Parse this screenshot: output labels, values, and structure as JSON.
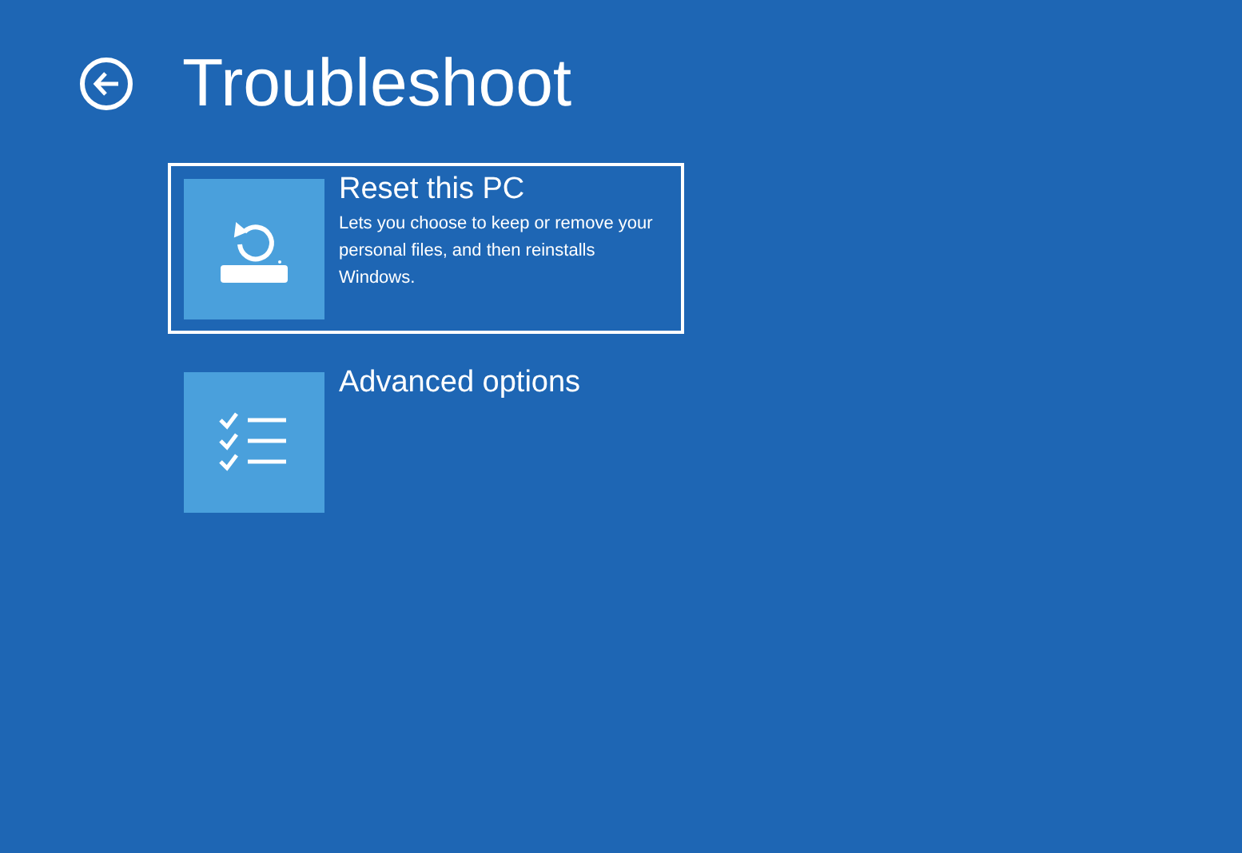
{
  "title": "Troubleshoot",
  "options": [
    {
      "kind": "reset",
      "label": "Reset this PC",
      "description": "Lets you choose to keep or remove your personal files, and then reinstalls Windows.",
      "selected": true
    },
    {
      "kind": "advanced",
      "label": "Advanced options",
      "selected": false
    }
  ]
}
